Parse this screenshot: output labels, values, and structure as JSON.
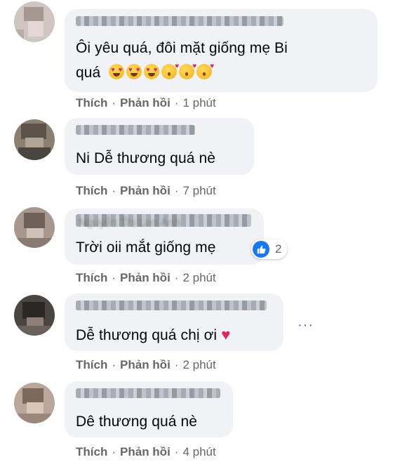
{
  "comments": [
    {
      "text_line1": "Ôi yêu quá, đôi mặt giống mẹ Bi",
      "text_line2": "quá",
      "emojis": [
        "heart-eyes-emoji",
        "heart-eyes-emoji",
        "heart-eyes-emoji",
        "kiss-emoji",
        "kiss-emoji",
        "kiss-emoji"
      ],
      "like": "Thích",
      "reply": "Phản hồi",
      "time": "1 phút"
    },
    {
      "text": "Ni Dễ thương quá nè",
      "like": "Thích",
      "reply": "Phản hồi",
      "time": "7 phút"
    },
    {
      "name_partial": "Nguyễn Thị Lan Anh",
      "text": "Trời oii mắt giống mẹ",
      "reaction_count": "2",
      "like": "Thích",
      "reply": "Phản hồi",
      "time": "2 phút"
    },
    {
      "text": "Dễ thương quá chị ơi",
      "like": "Thích",
      "reply": "Phản hồi",
      "time": "2 phút"
    },
    {
      "text": "Dê thương quá nè",
      "like": "Thích",
      "reply": "Phản hồi",
      "time": "4 phút"
    }
  ],
  "more_options": "···",
  "separator": "·",
  "colors": {
    "bubble": "#f0f2f5",
    "meta": "#65676b",
    "text": "#050505",
    "like_blue": "#1877f2",
    "heart": "#e0245e"
  }
}
